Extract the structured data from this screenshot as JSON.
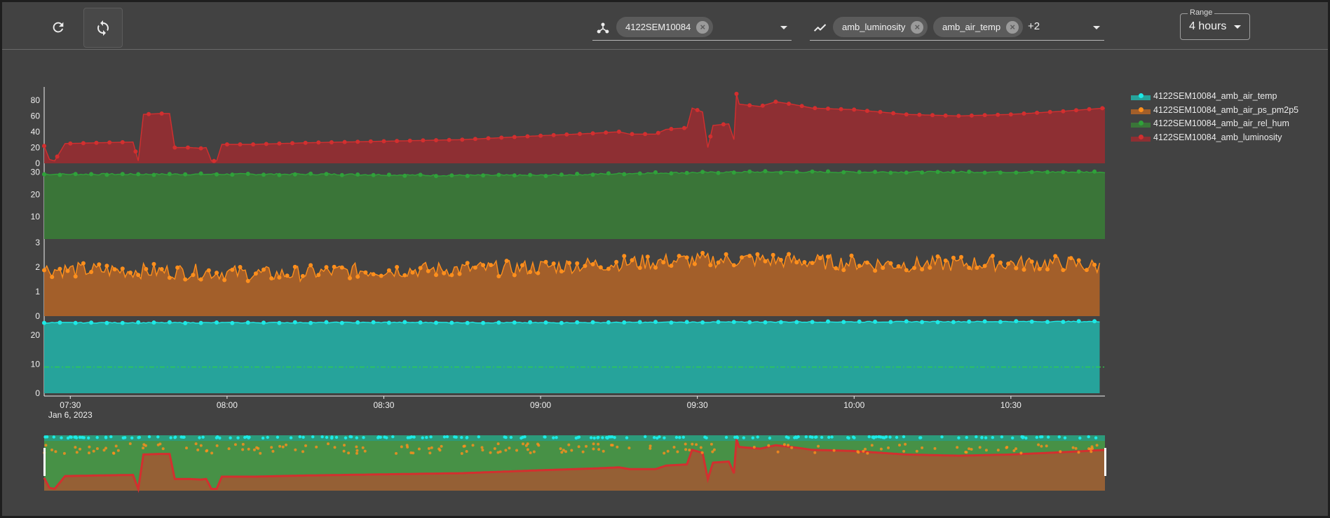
{
  "toolbar": {
    "refresh_icon": "refresh-icon",
    "autorefresh_icon": "sync-icon"
  },
  "device_select": {
    "icon": "device-hub-icon",
    "chips": [
      "4122SEM10084"
    ]
  },
  "metric_select": {
    "icon": "chart-line-icon",
    "chips": [
      "amb_luminosity",
      "amb_air_temp"
    ],
    "more": "+2"
  },
  "range": {
    "label": "Range",
    "value": "4 hours"
  },
  "colors": {
    "background": "#424242",
    "luminosity": "#d32f2f",
    "luminosity_fill": "#8e2f33",
    "rel_hum": "#2fa23a",
    "rel_hum_fill": "#3a7538",
    "pm2p5": "#ff8f1c",
    "pm2p5_fill": "#a35f2a",
    "air_temp": "#1de9e6",
    "air_temp_fill": "#26a39b",
    "threshold": "#2fd14a"
  },
  "chart_data": {
    "type": "area",
    "date_label": "Jan 6, 2023",
    "x_ticks": [
      "07:30",
      "08:00",
      "08:30",
      "09:00",
      "09:30",
      "10:00",
      "10:30"
    ],
    "x_start": "07:25",
    "x_end": "10:48",
    "legend": [
      {
        "name": "4122SEM10084_amb_air_temp",
        "color": "#1de9e6",
        "fill": "#26a39b"
      },
      {
        "name": "4122SEM10084_amb_air_ps_pm2p5",
        "color": "#ff8f1c",
        "fill": "#a35f2a"
      },
      {
        "name": "4122SEM10084_amb_air_rel_hum",
        "color": "#2fa23a",
        "fill": "#3a7538"
      },
      {
        "name": "4122SEM10084_amb_luminosity",
        "color": "#d32f2f",
        "fill": "#8e2f33"
      }
    ],
    "panels": [
      {
        "series": "4122SEM10084_amb_luminosity",
        "y_ticks": [
          0,
          20,
          40,
          60,
          80
        ],
        "ylim": [
          0,
          95
        ],
        "points": [
          [
            "07:25",
            22
          ],
          [
            "07:26",
            5
          ],
          [
            "07:27",
            3
          ],
          [
            "07:29",
            25
          ],
          [
            "07:35",
            26
          ],
          [
            "07:42",
            27
          ],
          [
            "07:43",
            3
          ],
          [
            "07:44",
            62
          ],
          [
            "07:47",
            63
          ],
          [
            "07:49",
            63
          ],
          [
            "07:50",
            20
          ],
          [
            "07:53",
            20
          ],
          [
            "07:55",
            19
          ],
          [
            "07:56",
            20
          ],
          [
            "07:57",
            3
          ],
          [
            "07:58",
            3
          ],
          [
            "07:59",
            24
          ],
          [
            "08:05",
            24
          ],
          [
            "08:15",
            26
          ],
          [
            "08:30",
            28
          ],
          [
            "08:45",
            30
          ],
          [
            "09:00",
            35
          ],
          [
            "09:10",
            38
          ],
          [
            "09:15",
            40
          ],
          [
            "09:17",
            37
          ],
          [
            "09:22",
            37
          ],
          [
            "09:24",
            43
          ],
          [
            "09:28",
            45
          ],
          [
            "09:29",
            70
          ],
          [
            "09:31",
            65
          ],
          [
            "09:32",
            20
          ],
          [
            "09:33",
            48
          ],
          [
            "09:36",
            50
          ],
          [
            "09:37",
            30
          ],
          [
            "09:37.5",
            88
          ],
          [
            "09:38",
            75
          ],
          [
            "09:42",
            72
          ],
          [
            "09:45",
            78
          ],
          [
            "09:48",
            75
          ],
          [
            "09:52",
            70
          ],
          [
            "10:00",
            68
          ],
          [
            "10:10",
            62
          ],
          [
            "10:20",
            60
          ],
          [
            "10:30",
            62
          ],
          [
            "10:40",
            66
          ],
          [
            "10:48",
            70
          ]
        ]
      },
      {
        "series": "4122SEM10084_amb_air_rel_hum",
        "y_ticks": [
          10,
          20,
          30
        ],
        "ylim": [
          0,
          32
        ],
        "points": [
          [
            "07:25",
            29
          ],
          [
            "08:00",
            29
          ],
          [
            "08:20",
            29
          ],
          [
            "08:40",
            28.5
          ],
          [
            "09:00",
            28.5
          ],
          [
            "09:20",
            29.5
          ],
          [
            "09:40",
            30
          ],
          [
            "10:00",
            30
          ],
          [
            "10:20",
            30
          ],
          [
            "10:48",
            30
          ]
        ]
      },
      {
        "series": "4122SEM10084_amb_air_ps_pm2p5",
        "y_ticks": [
          0,
          1,
          2,
          3
        ],
        "ylim": [
          0,
          3.05
        ],
        "points": [
          [
            "07:25",
            1.9
          ],
          [
            "07:40",
            1.85
          ],
          [
            "07:55",
            1.8
          ],
          [
            "08:10",
            1.7
          ],
          [
            "08:25",
            1.85
          ],
          [
            "08:40",
            1.9
          ],
          [
            "08:55",
            1.95
          ],
          [
            "09:10",
            2.1
          ],
          [
            "09:25",
            2.25
          ],
          [
            "09:40",
            2.3
          ],
          [
            "09:55",
            2.2
          ],
          [
            "10:10",
            2.1
          ],
          [
            "10:25",
            2.15
          ],
          [
            "10:40",
            2.15
          ],
          [
            "10:47",
            2.0
          ]
        ]
      },
      {
        "series": "4122SEM10084_amb_air_temp",
        "y_ticks": [
          0,
          10,
          20
        ],
        "ylim": [
          0,
          25.5
        ],
        "threshold": 9,
        "points": [
          [
            "07:25",
            24.2
          ],
          [
            "08:00",
            24.2
          ],
          [
            "08:30",
            24.3
          ],
          [
            "09:00",
            24.2
          ],
          [
            "09:30",
            24.4
          ],
          [
            "10:00",
            24.5
          ],
          [
            "10:30",
            24.6
          ],
          [
            "10:48",
            24.6
          ]
        ]
      }
    ]
  }
}
